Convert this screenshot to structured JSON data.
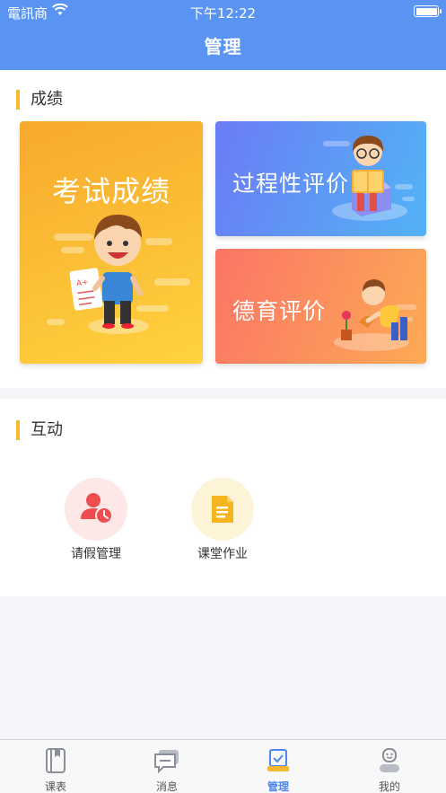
{
  "status_bar": {
    "carrier": "電訊商",
    "time": "下午12:22"
  },
  "nav": {
    "title": "管理"
  },
  "grades": {
    "section_title": "成绩",
    "cards": {
      "exam": "考试成绩",
      "process": "过程性评价",
      "moral": "德育评价"
    }
  },
  "interaction": {
    "section_title": "互动",
    "leave": "请假管理",
    "homework": "课堂作业"
  },
  "tabbar": {
    "schedule": "课表",
    "messages": "消息",
    "manage": "管理",
    "mine": "我的"
  },
  "colors": {
    "primary": "#5a94f2",
    "accent_bar": "#f5b82e",
    "active_tab": "#4c87f0"
  }
}
